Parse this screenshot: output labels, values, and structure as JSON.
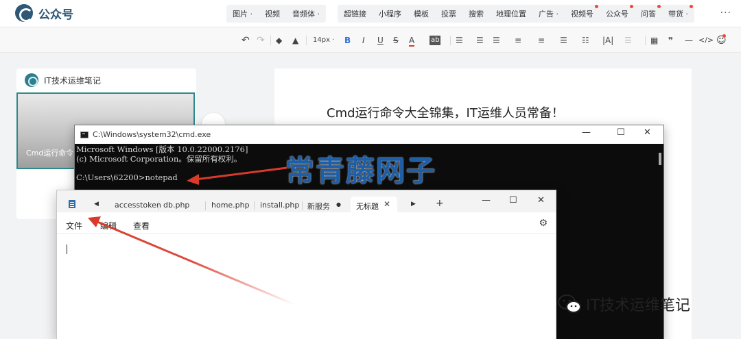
{
  "app": {
    "logo_text": "公众号"
  },
  "topnav": {
    "group1": [
      {
        "label": "图片",
        "caret": true,
        "dot": false
      },
      {
        "label": "视频",
        "caret": false,
        "dot": false
      },
      {
        "label": "音频体",
        "caret": true,
        "dot": false
      }
    ],
    "group2": [
      {
        "label": "超链接",
        "caret": false,
        "dot": false
      },
      {
        "label": "小程序",
        "caret": false,
        "dot": false
      },
      {
        "label": "模板",
        "caret": false,
        "dot": false
      },
      {
        "label": "投票",
        "caret": false,
        "dot": false
      },
      {
        "label": "搜索",
        "caret": false,
        "dot": false
      },
      {
        "label": "地理位置",
        "caret": false,
        "dot": false
      },
      {
        "label": "广告",
        "caret": true,
        "dot": false
      },
      {
        "label": "视频号",
        "caret": false,
        "dot": true
      },
      {
        "label": "公众号",
        "caret": false,
        "dot": true
      },
      {
        "label": "问答",
        "caret": false,
        "dot": true
      },
      {
        "label": "带货",
        "caret": true,
        "dot": true
      }
    ],
    "more": "···"
  },
  "toolbar": {
    "undo": "↶",
    "redo": "↷",
    "font_size": "14px ·",
    "bold": "B",
    "italic": "I",
    "underline": "U",
    "strike": "S",
    "font_color": "A",
    "bg_color": "ab"
  },
  "sidebar": {
    "account_name": "IT技术运维笔记",
    "thumb_title": "Cmd运行命令大全锦"
  },
  "editor": {
    "article_title": "Cmd运行命令大全锦集，IT运维人员常备！"
  },
  "cmd": {
    "title": "C:\\Windows\\system32\\cmd.exe",
    "lines": [
      "Microsoft Windows [版本 10.0.22000.2176]",
      "(c) Microsoft Corporation。保留所有权利。",
      "",
      "C:\\Users\\62200>notepad"
    ]
  },
  "overlay_text": "常青藤网子",
  "notepad": {
    "tabs": [
      "accesstoken",
      "db.php",
      "home.php",
      "install.php",
      "新服务"
    ],
    "active_tab": "无标题",
    "menus": [
      "文件",
      "编辑",
      "查看"
    ]
  },
  "bottom_watermark": "IT技术运维笔记",
  "colors": {
    "brand": "#2f5876",
    "accent_red": "#d93a2b",
    "overlay_blue": "#1e5ea6"
  }
}
